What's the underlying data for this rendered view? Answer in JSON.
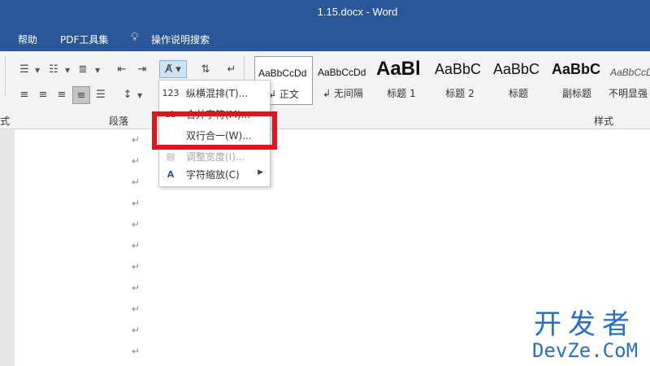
{
  "window": {
    "title": "1.15.docx  -  Word"
  },
  "menubar": {
    "items": [
      "帮助",
      "PDF工具集",
      "操作说明搜索"
    ]
  },
  "ribbon": {
    "paragraph_group_label": "段落",
    "styles_group_label": "样式",
    "left_cut_label": "式",
    "styles": [
      {
        "sample": "AaBbCcDd",
        "name": "↲ 正文"
      },
      {
        "sample": "AaBbCcDd",
        "name": "↲ 无间隔"
      },
      {
        "sample": "AaBl",
        "name": "标题 1"
      },
      {
        "sample": "AaBbC",
        "name": "标题 2"
      },
      {
        "sample": "AaBbC",
        "name": "标题"
      },
      {
        "sample": "AaBbC",
        "name": "副标题"
      },
      {
        "sample": "AaBbCcD",
        "name": "不明显强"
      }
    ]
  },
  "dropdown": {
    "items": [
      {
        "icon": "123",
        "label": "纵横混排(T)...",
        "disabled": false
      },
      {
        "icon": "ab",
        "label": "合并字符(M)...",
        "disabled": false
      },
      {
        "icon": "",
        "label": "双行合一(W)...",
        "disabled": false
      },
      {
        "icon": "▤",
        "label": "调整宽度(I)...",
        "disabled": true
      },
      {
        "icon": "A",
        "label": "字符缩放(C)",
        "disabled": false,
        "submenu": true
      }
    ]
  },
  "document": {
    "paragraph_mark": "↵",
    "paragraph_count": 13
  },
  "watermark": {
    "cn": "开发者",
    "en": "DevZe.CoM"
  },
  "colors": {
    "title_bar": "#2b579a",
    "highlight": "#e0141b",
    "watermark": "#2a6fc0"
  }
}
